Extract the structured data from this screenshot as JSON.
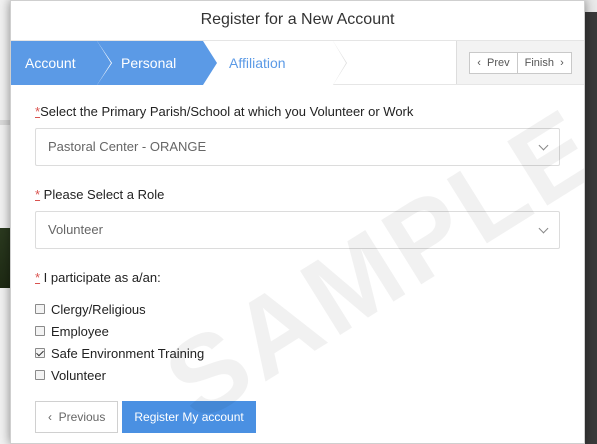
{
  "modal": {
    "title": "Register for a New Account"
  },
  "wizard": {
    "steps": [
      {
        "label": "Account"
      },
      {
        "label": "Personal"
      },
      {
        "label": "Affiliation"
      }
    ],
    "nav": {
      "prev": "Prev",
      "finish": "Finish"
    },
    "colors": {
      "active": "#5b9ae6"
    }
  },
  "form": {
    "parish": {
      "required_mark": "*",
      "label": "Select the Primary Parish/School at which you Volunteer or Work",
      "value": "Pastoral Center - ORANGE"
    },
    "role": {
      "required_mark": "*",
      "label": " Please Select a Role",
      "value": "Volunteer"
    },
    "participate": {
      "required_mark": "*",
      "label": " I participate as a/an:",
      "options": [
        {
          "label": "Clergy/Religious",
          "checked": false
        },
        {
          "label": "Employee",
          "checked": false
        },
        {
          "label": "Safe Environment Training",
          "checked": true
        },
        {
          "label": "Volunteer",
          "checked": false
        }
      ]
    }
  },
  "buttons": {
    "previous": "Previous",
    "register": "Register My account"
  },
  "watermark": "SAMPLE"
}
